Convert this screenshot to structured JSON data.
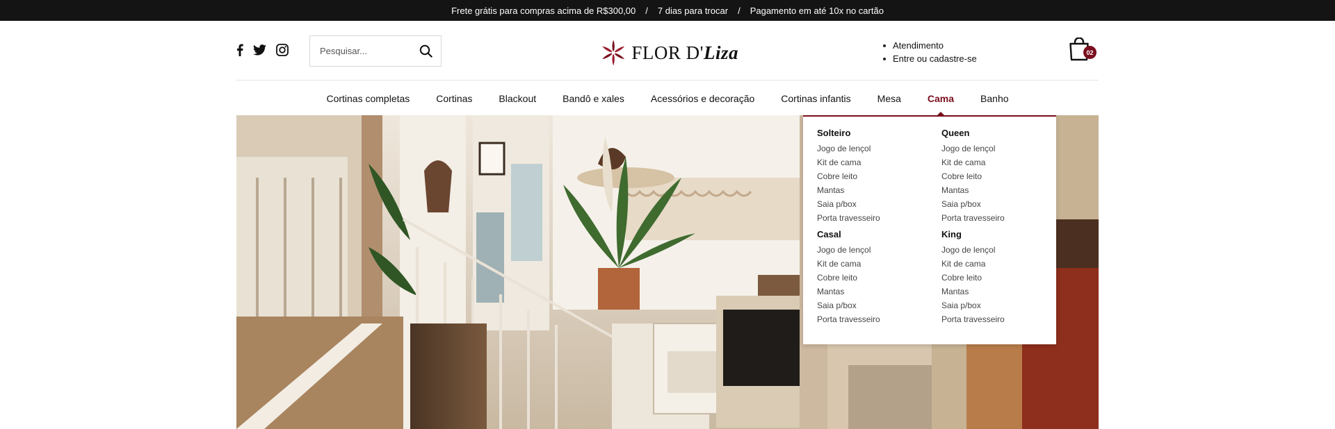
{
  "topbar": {
    "item1": "Frete grátis para compras acima de R$300,00",
    "item2": "7 dias para trocar",
    "item3": "Pagamento em até 10x no cartão",
    "separator": "/"
  },
  "social": {
    "facebook": "facebook-icon",
    "twitter": "twitter-icon",
    "instagram": "instagram-icon"
  },
  "search": {
    "placeholder": "Pesquisar...",
    "icon": "search-icon"
  },
  "logo": {
    "text_main": "FLOR D'",
    "text_script": "Liza"
  },
  "account": {
    "service": "Atendimento",
    "login": "Entre ou cadastre-se"
  },
  "cart": {
    "count": "02",
    "icon": "shopping-bag-icon"
  },
  "nav": {
    "items": [
      "Cortinas completas",
      "Cortinas",
      "Blackout",
      "Bandô e xales",
      "Acessórios e decoração",
      "Cortinas infantis",
      "Mesa",
      "Cama",
      "Banho"
    ],
    "active": "Cama"
  },
  "dropdown": {
    "solteiro": {
      "title": "Solteiro",
      "items": [
        "Jogo de lençol",
        "Kit de cama",
        "Cobre leito",
        "Mantas",
        "Saia p/box",
        "Porta travesseiro"
      ]
    },
    "queen": {
      "title": "Queen",
      "items": [
        "Jogo de lençol",
        "Kit de cama",
        "Cobre leito",
        "Mantas",
        "Saia p/box",
        "Porta travesseiro"
      ]
    },
    "casal": {
      "title": "Casal",
      "items": [
        "Jogo de lençol",
        "Kit de cama",
        "Cobre leito",
        "Mantas",
        "Saia p/box",
        "Porta travesseiro"
      ]
    },
    "king": {
      "title": "King",
      "items": [
        "Jogo de lençol",
        "Kit de cama",
        "Cobre leito",
        "Mantas",
        "Saia p/box",
        "Porta travesseiro"
      ]
    }
  },
  "colors": {
    "accent": "#7a0f1e",
    "topbar_bg": "#141414"
  }
}
